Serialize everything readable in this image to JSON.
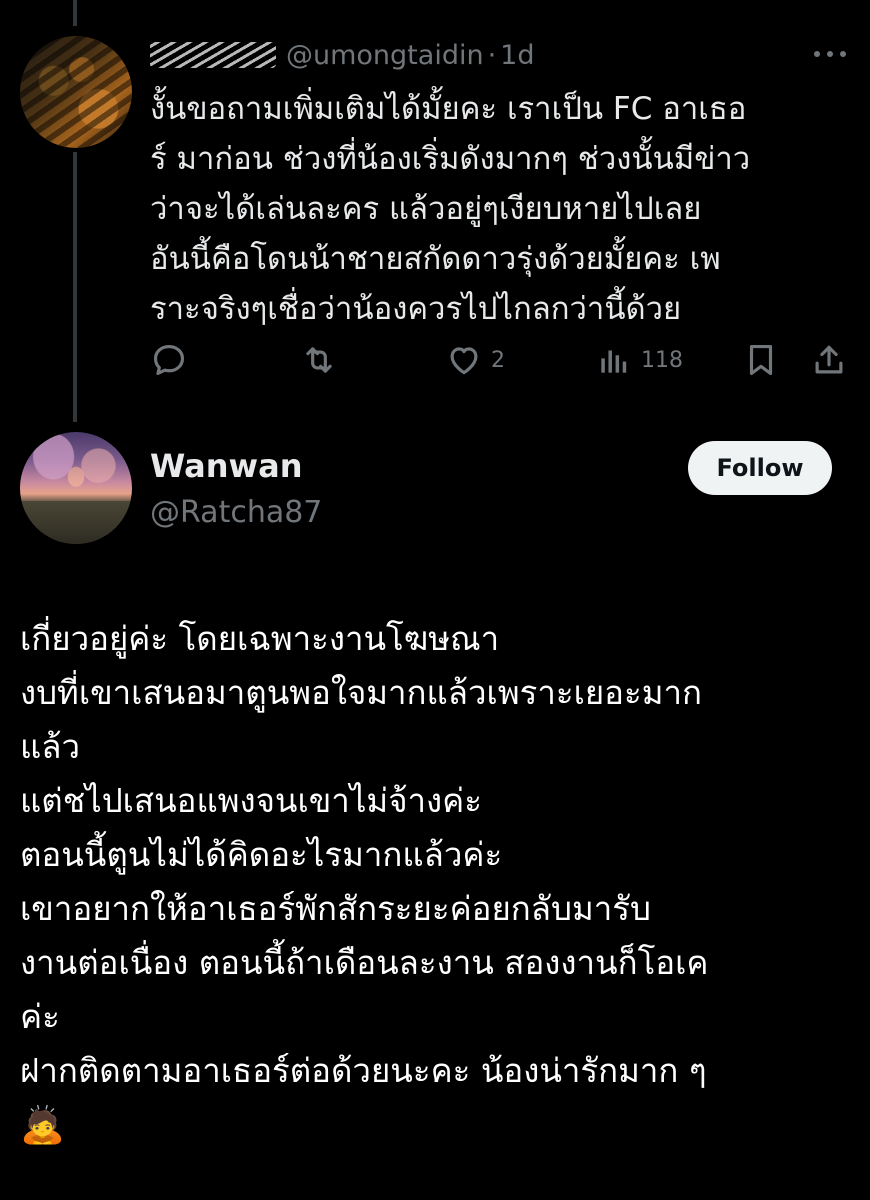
{
  "reply": {
    "handle": "@umongtaidin",
    "separator": "·",
    "time": "1d",
    "text": "งั้นขอถามเพิ่มเติมได้มั้ยคะ เราเป็น FC อาเธอ\nร์ มาก่อน ช่วงที่น้องเริ่มดังมากๆ ช่วงนั้นมีข่าว\nว่าจะได้เล่นละคร แล้วอยู่ๆเงียบหายไปเลย\nอันนี้คือโดนน้าชายสกัดดาวรุ่งด้วยมั้ยคะ เพ\nราะจริงๆเชื่อว่าน้องควรไปไกลกว่านี้ด้วย",
    "actions": {
      "reply_icon": "reply-icon",
      "retweet_icon": "retweet-icon",
      "like_icon": "heart-icon",
      "like_count": "2",
      "views_icon": "views-icon",
      "views_count": "118",
      "bookmark_icon": "bookmark-icon",
      "share_icon": "share-icon"
    }
  },
  "post": {
    "display_name": "Wanwan",
    "handle": "@Ratcha87",
    "follow_label": "Follow",
    "lines": [
      "เกี่ยวอยู่ค่ะ โดยเฉพาะงานโฆษณา",
      "งบที่เขาเสนอมาตูนพอใจมากแล้วเพราะเยอะมาก",
      "แล้ว",
      "แต่ชไปเสนอแพงจนเขาไม่จ้างค่ะ",
      "ตอนนี้ตูนไม่ได้คิดอะไรมากแล้วค่ะ",
      "เขาอยากให้อาเธอร์พักสักระยะค่อยกลับมารับ",
      "งานต่อเนื่อง ตอนนี้ถ้าเดือนละงาน สองงานก็โอเค",
      "ค่ะ",
      "ฝากติดตามอาเธอร์ต่อด้วยนะคะ น้องน่ารักมาก ๆ"
    ],
    "emoji": "🙇"
  },
  "colors": {
    "background": "#000000",
    "text": "#e7e9ea",
    "muted": "#71767b",
    "thread_line": "#333639",
    "follow_bg": "#eff3f4",
    "follow_text": "#0f1419"
  }
}
